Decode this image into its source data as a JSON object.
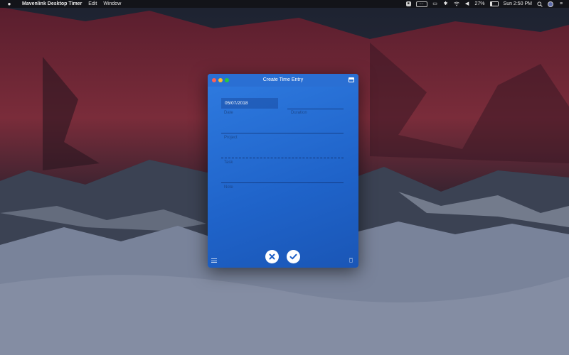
{
  "menubar": {
    "app_name": "Mavenlink Desktop Timer",
    "menus": [
      "Edit",
      "Window"
    ],
    "status": {
      "battery_percent": "27%",
      "battery_level": 0.27,
      "time": "Sun 2:50 PM"
    }
  },
  "window": {
    "title": "Create Time Entry",
    "date": {
      "value": "05/07/2018",
      "label": "Date"
    },
    "duration_label": "Duration",
    "project_label": "Project",
    "task_label": "Task",
    "note_label": "Note"
  },
  "icons": {
    "apple": "apple-logo-icon",
    "cancel": "close-x-icon",
    "confirm": "checkmark-icon",
    "menu": "hamburger-menu-icon",
    "trash": "trash-icon"
  },
  "colors": {
    "window_accent": "#2a6fd3",
    "button_icon": "#1f5fc7"
  }
}
